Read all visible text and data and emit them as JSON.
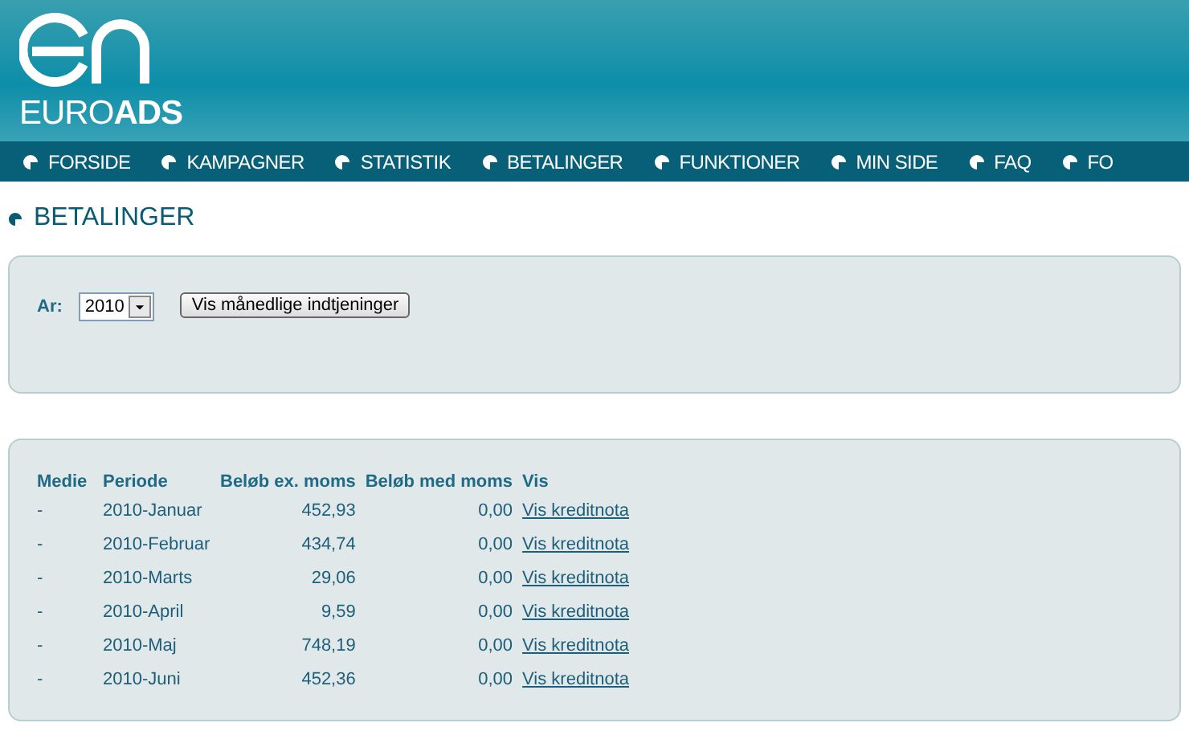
{
  "logo": {
    "wordmark": "EURO**ADS**"
  },
  "nav": [
    {
      "label": "FORSIDE"
    },
    {
      "label": "KAMPAGNER"
    },
    {
      "label": "STATISTIK"
    },
    {
      "label": "BETALINGER"
    },
    {
      "label": "FUNKTIONER"
    },
    {
      "label": "MIN SIDE"
    },
    {
      "label": "FAQ"
    },
    {
      "label": "FO"
    }
  ],
  "page_title": "BETALINGER",
  "filter": {
    "label": "Ar:",
    "year": "2010",
    "button": "Vis månedlige indtjeninger"
  },
  "table": {
    "columns": [
      "Medie",
      "Periode",
      "Beløb ex. moms",
      "Beløb med moms",
      "Vis"
    ],
    "rows": [
      {
        "medie": "-",
        "periode": "2010-Januar",
        "ex_moms": "452,93",
        "med_moms": "0,00",
        "link": "Vis kreditnota"
      },
      {
        "medie": "-",
        "periode": "2010-Februar",
        "ex_moms": "434,74",
        "med_moms": "0,00",
        "link": "Vis kreditnota"
      },
      {
        "medie": "-",
        "periode": "2010-Marts",
        "ex_moms": "29,06",
        "med_moms": "0,00",
        "link": "Vis kreditnota"
      },
      {
        "medie": "-",
        "periode": "2010-April",
        "ex_moms": "9,59",
        "med_moms": "0,00",
        "link": "Vis kreditnota"
      },
      {
        "medie": "-",
        "periode": "2010-Maj",
        "ex_moms": "748,19",
        "med_moms": "0,00",
        "link": "Vis kreditnota"
      },
      {
        "medie": "-",
        "periode": "2010-Juni",
        "ex_moms": "452,36",
        "med_moms": "0,00",
        "link": "Vis kreditnota"
      }
    ]
  }
}
